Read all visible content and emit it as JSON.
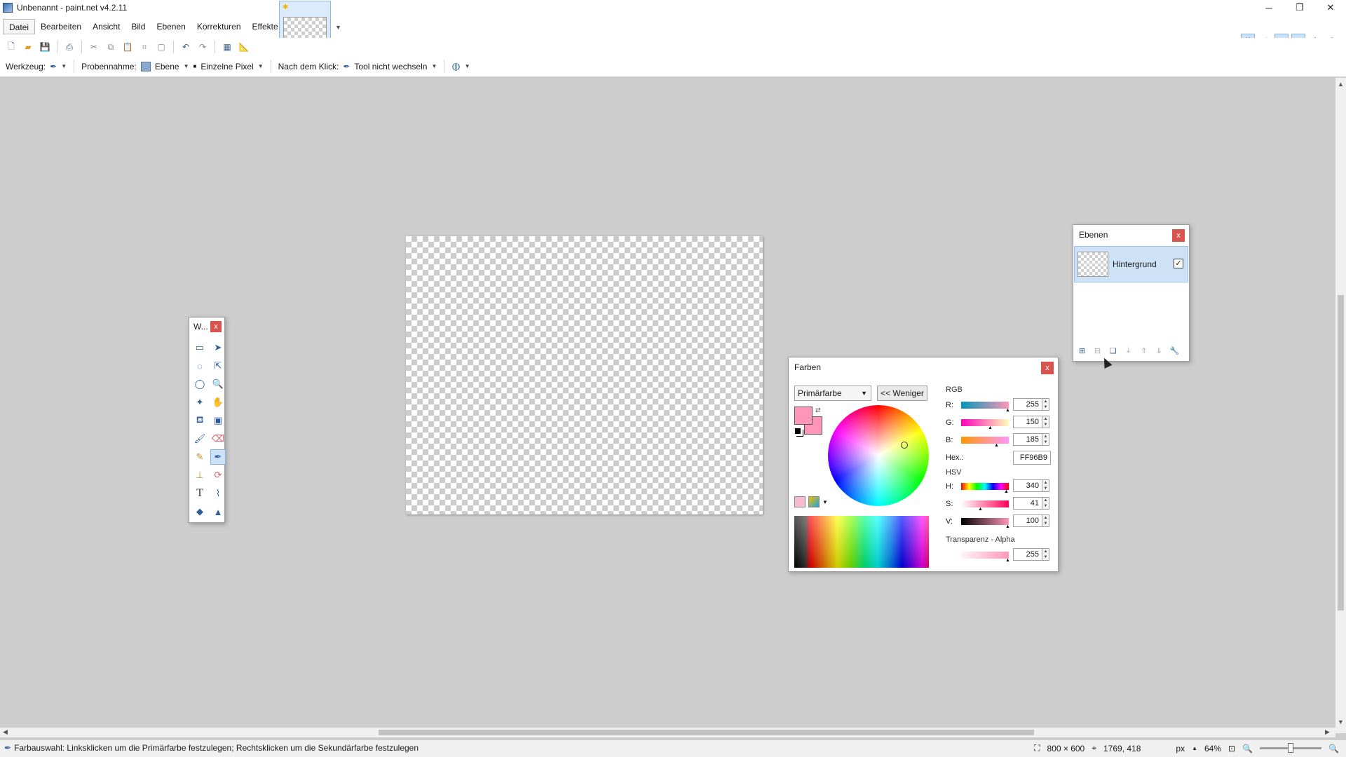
{
  "window": {
    "title": "Unbenannt - paint.net v4.2.11",
    "controls": {
      "minimize": "─",
      "restore": "❐",
      "close": "✕"
    }
  },
  "menu": {
    "items": [
      "Datei",
      "Bearbeiten",
      "Ansicht",
      "Bild",
      "Ebenen",
      "Korrekturen",
      "Effekte"
    ]
  },
  "toolbar": {
    "icons": [
      "new-icon",
      "open-icon",
      "save-icon",
      "print-icon",
      "cut-icon",
      "copy-icon",
      "paste-icon",
      "crop-icon",
      "deselect-icon",
      "undo-icon",
      "redo-icon",
      "grid-icon",
      "ruler-icon"
    ]
  },
  "tool_options": {
    "werkzeug_label": "Werkzeug:",
    "probennahme_label": "Probennahme:",
    "ebene_label": "Ebene",
    "einzelne_pixel_label": "Einzelne Pixel",
    "nach_klick_label": "Nach dem Klick:",
    "tool_nicht_wechseln_label": "Tool nicht wechseln"
  },
  "tools_window": {
    "title": "W...",
    "close": "x",
    "tools": [
      "rectangle-select",
      "move-selected",
      "lasso-select",
      "move-selection",
      "ellipse-select",
      "zoom",
      "magic-wand",
      "pan",
      "paint-bucket",
      "gradient",
      "paintbrush",
      "eraser",
      "pencil",
      "color-picker",
      "clone-stamp",
      "recolor",
      "text",
      "line-curve",
      "shapes",
      ""
    ]
  },
  "layers_window": {
    "title": "Ebenen",
    "close": "x",
    "layer_name": "Hintergrund",
    "layer_visible": true
  },
  "colors_window": {
    "title": "Farben",
    "close": "x",
    "mode_select": "Primärfarbe",
    "less_button": "<< Weniger",
    "rgb_label": "RGB",
    "r_label": "R:",
    "g_label": "G:",
    "b_label": "B:",
    "r_value": "255",
    "g_value": "150",
    "b_value": "185",
    "hex_label": "Hex.:",
    "hex_value": "FF96B9",
    "hsv_label": "HSV",
    "h_label": "H:",
    "s_label": "S:",
    "v_label": "V:",
    "h_value": "340",
    "s_value": "41",
    "v_value": "100",
    "alpha_label": "Transparenz - Alpha",
    "alpha_value": "255",
    "primary_color": "#FF96B9"
  },
  "statusbar": {
    "hint": "Farbauswahl: Linksklicken um die Primärfarbe festzulegen; Rechtsklicken um die Sekundärfarbe festzulegen",
    "image_size": "800 × 600",
    "cursor_pos": "1769, 418",
    "unit": "px",
    "zoom": "64%"
  }
}
